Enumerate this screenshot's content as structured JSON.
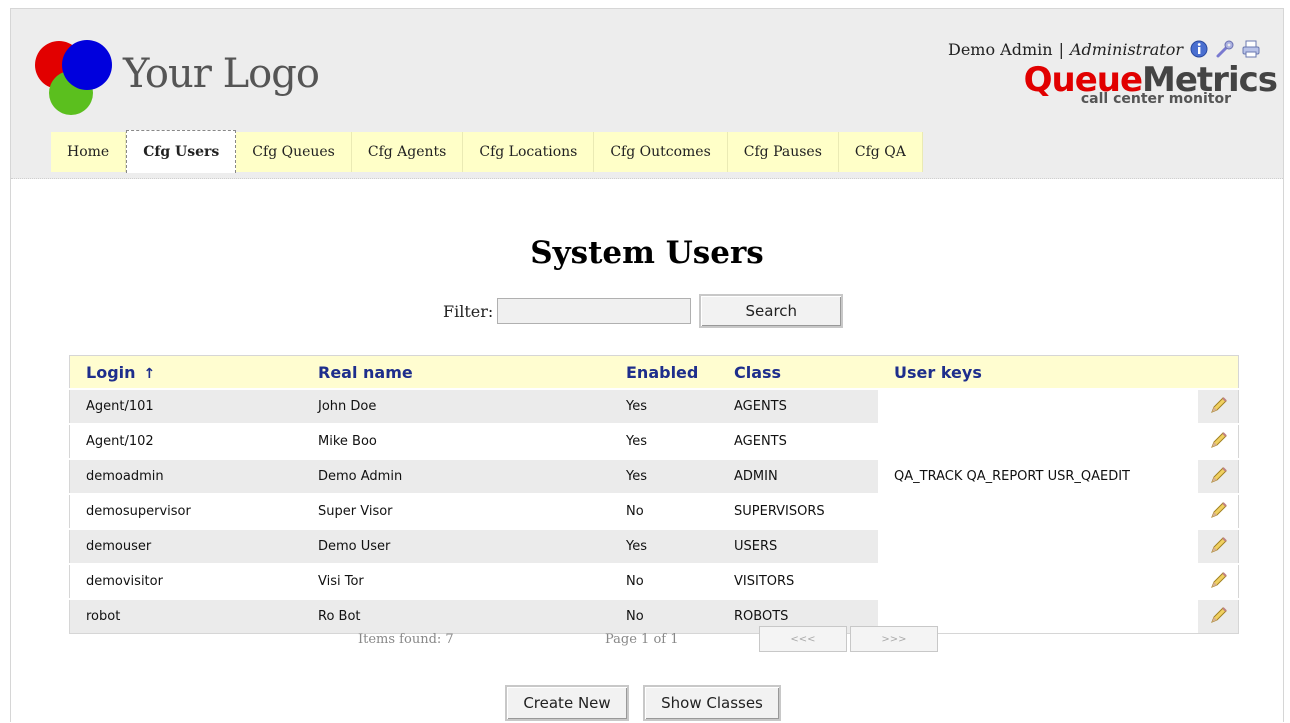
{
  "header": {
    "logo_text": "Your Logo",
    "user_name": "Demo Admin",
    "separator": "|",
    "user_role": "Administrator",
    "icons": [
      "info-icon",
      "tools-icon",
      "print-icon"
    ],
    "brand_queue": "Queue",
    "brand_metrics": "Metrics",
    "brand_sub": "call center monitor"
  },
  "tabs": [
    {
      "label": "Home",
      "active": false
    },
    {
      "label": "Cfg Users",
      "active": true
    },
    {
      "label": "Cfg Queues",
      "active": false
    },
    {
      "label": "Cfg Agents",
      "active": false
    },
    {
      "label": "Cfg Locations",
      "active": false
    },
    {
      "label": "Cfg Outcomes",
      "active": false
    },
    {
      "label": "Cfg Pauses",
      "active": false
    },
    {
      "label": "Cfg QA",
      "active": false
    }
  ],
  "page": {
    "title": "System Users",
    "filter_label": "Filter:",
    "filter_value": "",
    "search_label": "Search"
  },
  "table": {
    "columns": [
      "Login",
      "Real name",
      "Enabled",
      "Class",
      "User keys"
    ],
    "sort_indicator": "↑",
    "rows": [
      {
        "login": "Agent/101",
        "real_name": "John Doe",
        "enabled": "Yes",
        "class": "AGENTS",
        "keys": ""
      },
      {
        "login": "Agent/102",
        "real_name": "Mike Boo",
        "enabled": "Yes",
        "class": "AGENTS",
        "keys": ""
      },
      {
        "login": "demoadmin",
        "real_name": "Demo Admin",
        "enabled": "Yes",
        "class": "ADMIN",
        "keys": "QA_TRACK QA_REPORT USR_QAEDIT"
      },
      {
        "login": "demosupervisor",
        "real_name": "Super Visor",
        "enabled": "No",
        "class": "SUPERVISORS",
        "keys": ""
      },
      {
        "login": "demouser",
        "real_name": "Demo User",
        "enabled": "Yes",
        "class": "USERS",
        "keys": ""
      },
      {
        "login": "demovisitor",
        "real_name": "Visi Tor",
        "enabled": "No",
        "class": "VISITORS",
        "keys": ""
      },
      {
        "login": "robot",
        "real_name": "Ro Bot",
        "enabled": "No",
        "class": "ROBOTS",
        "keys": ""
      }
    ]
  },
  "pager": {
    "items_found": "Items found: 7",
    "page_info": "Page 1 of 1",
    "prev_label": "<<<",
    "next_label": ">>>"
  },
  "actions": {
    "create_new": "Create New",
    "show_classes": "Show Classes"
  },
  "colors": {
    "tab_bg": "#ffffc8",
    "header_bg": "#ededed",
    "column_header_text": "#1e2e8c",
    "brand_red": "#e10000"
  }
}
